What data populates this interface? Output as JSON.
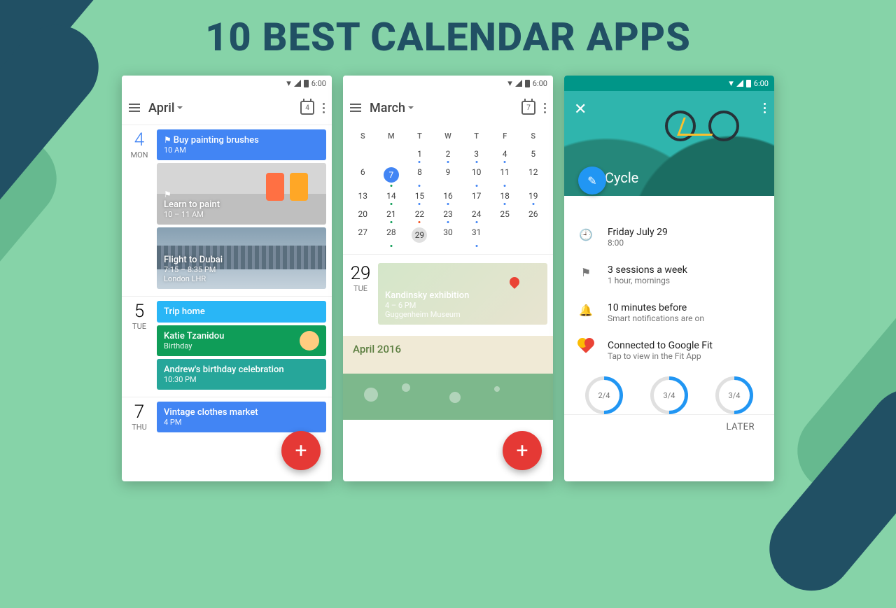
{
  "headline": "10 BEST CALENDAR APPS",
  "status_time": "6:00",
  "phone1": {
    "month": "April",
    "today_num": "4",
    "days": [
      {
        "num": "4",
        "name": "Mon",
        "today": true,
        "events": [
          {
            "kind": "blue",
            "title": "Buy painting brushes",
            "sub": "10 AM",
            "icon": "⚑"
          },
          {
            "kind": "img paint",
            "title": "Learn to paint",
            "sub": "10 – 11 AM",
            "icon": "⚑"
          },
          {
            "kind": "img skyline",
            "title": "Flight to Dubai",
            "sub": "7:15 – 8:35 PM\nLondon LHR"
          }
        ]
      },
      {
        "num": "5",
        "name": "Tue",
        "events": [
          {
            "kind": "cyan",
            "title": "Trip home",
            "sub": ""
          },
          {
            "kind": "green avatar",
            "title": "Katie Tzanidou",
            "sub": "Birthday"
          },
          {
            "kind": "teal2",
            "title": "Andrew's birthday celebration",
            "sub": "10:30 PM"
          }
        ]
      },
      {
        "num": "7",
        "name": "Thu",
        "events": [
          {
            "kind": "blue",
            "title": "Vintage clothes market",
            "sub": "4 PM"
          }
        ]
      }
    ]
  },
  "phone2": {
    "month": "March",
    "today_num": "7",
    "selected_day": 7,
    "current_day": 29,
    "dow": [
      "S",
      "M",
      "T",
      "W",
      "T",
      "F",
      "S"
    ],
    "weeks": [
      [
        "",
        "",
        "1",
        "2",
        "3",
        "4",
        "5"
      ],
      [
        "6",
        "7",
        "8",
        "9",
        "10",
        "11",
        "12"
      ],
      [
        "13",
        "14",
        "15",
        "16",
        "17",
        "18",
        "19"
      ],
      [
        "20",
        "21",
        "22",
        "23",
        "24",
        "25",
        "26"
      ],
      [
        "27",
        "28",
        "29",
        "30",
        "31",
        "",
        ""
      ]
    ],
    "agenda": {
      "num": "29",
      "name": "Tue",
      "event": {
        "title": "Kandinsky exhibition",
        "sub": "4 – 6 PM",
        "loc": "Guggenheim Museum"
      }
    },
    "next_month": "April 2016"
  },
  "phone3": {
    "title": "Cycle",
    "rows": [
      {
        "icon": "clock",
        "p": "Friday July 29",
        "s": "8:00"
      },
      {
        "icon": "flag",
        "p": "3 sessions a week",
        "s": "1 hour, mornings"
      },
      {
        "icon": "bell",
        "p": "10 minutes before",
        "s": "Smart notifications are on"
      },
      {
        "icon": "heart",
        "p": "Connected to Google Fit",
        "s": "Tap to view in the Fit App"
      }
    ],
    "rings": [
      "2/4",
      "3/4",
      "3/4"
    ],
    "later": "LATER"
  }
}
